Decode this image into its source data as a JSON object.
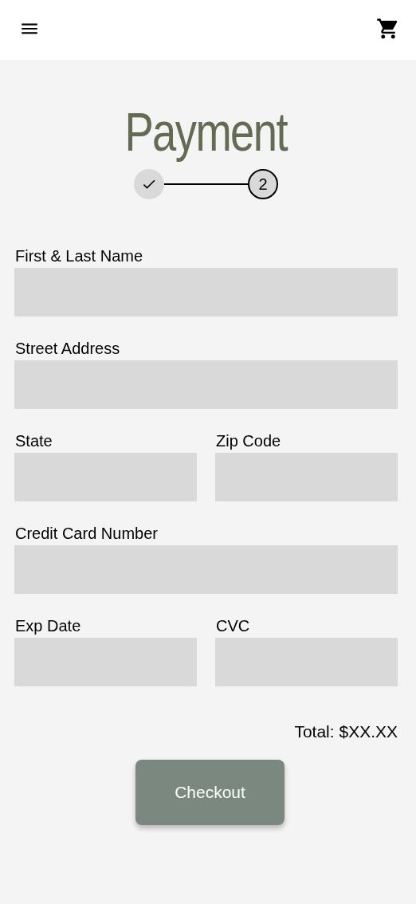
{
  "title": "Payment",
  "steps": [
    {
      "completed": true
    },
    {
      "label": "2",
      "completed": false
    }
  ],
  "form_rows": [
    [
      {
        "label": "First & Last Name"
      }
    ],
    [
      {
        "label": "Street Address"
      }
    ],
    [
      {
        "label": "State"
      },
      {
        "label": "Zip Code"
      }
    ],
    [
      {
        "label": "Credit Card Number"
      }
    ],
    [
      {
        "label": "Exp Date"
      },
      {
        "label": "CVC"
      }
    ]
  ],
  "total": "Total: $XX.XX",
  "checkout_button": "Checkout"
}
